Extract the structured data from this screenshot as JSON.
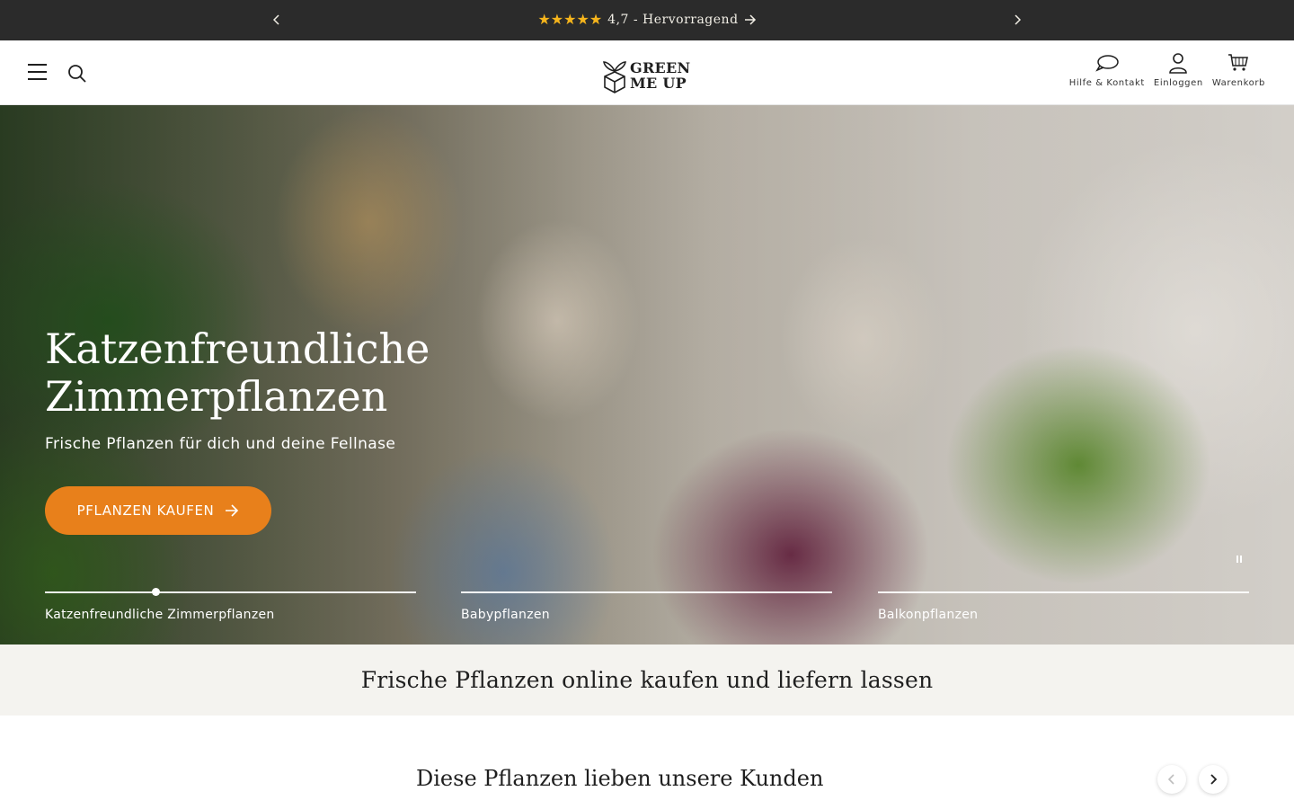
{
  "announcement": {
    "stars": "★★★★★",
    "text": "4,7 - Hervorragend",
    "icons": [
      "chevron-left-icon",
      "chevron-right-icon",
      "arrow-right-icon"
    ]
  },
  "header": {
    "logo_line1": "GREEN",
    "logo_line2": "ME UP",
    "actions": [
      {
        "label": "Hilfe & Kontakt",
        "icon": "chat-bubble-icon"
      },
      {
        "label": "Einloggen",
        "icon": "user-icon"
      },
      {
        "label": "Warenkorb",
        "icon": "cart-icon"
      }
    ]
  },
  "hero": {
    "title_line1": "Katzenfreundliche",
    "title_line2": "Zimmerpflanzen",
    "subtitle": "Frische Pflanzen für dich und deine Fellnase",
    "cta_label": "PFLANZEN KAUFEN",
    "slides": [
      {
        "label": "Katzenfreundliche Zimmerpflanzen",
        "active": true
      },
      {
        "label": "Babypflanzen",
        "active": false
      },
      {
        "label": "Balkonpflanzen",
        "active": false
      }
    ],
    "active_slide_progress": 0.3
  },
  "intro": {
    "heading": "Frische Pflanzen online kaufen und liefern lassen"
  },
  "favorites": {
    "heading": "Diese Pflanzen lieben unsere Kunden"
  },
  "colors": {
    "announcement_bg": "#2b2b2b",
    "cta": "#e8801b",
    "stars": "#f6b51c",
    "intro_bg": "#f4f3ef"
  }
}
